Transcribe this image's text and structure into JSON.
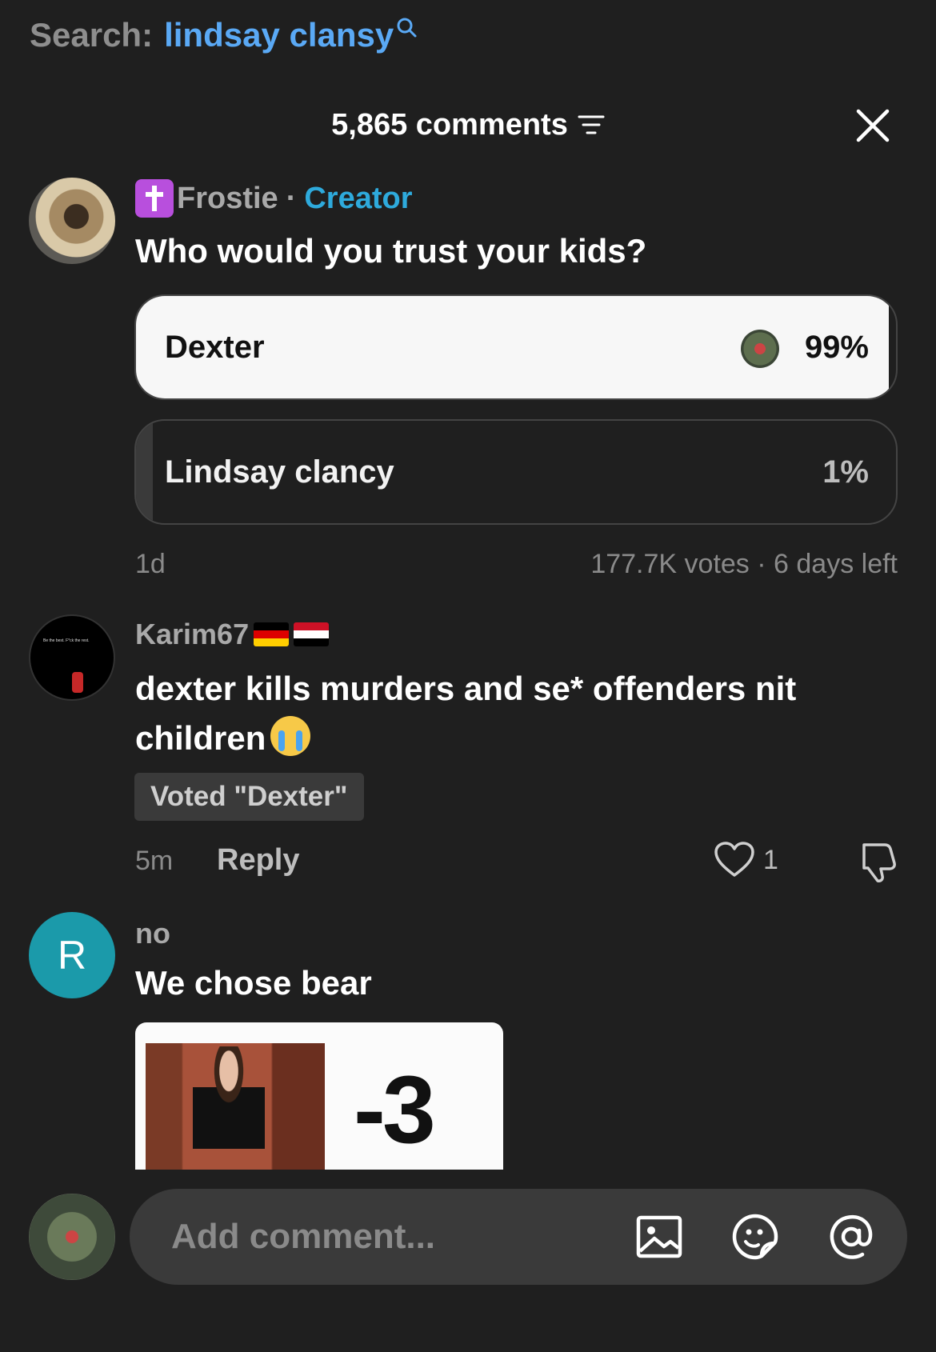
{
  "search": {
    "label": "Search:",
    "query": "lindsay clansy"
  },
  "header": {
    "comment_count": "5,865 comments"
  },
  "comments": [
    {
      "username": "Frostie",
      "separator": "·",
      "badge": "Creator",
      "text": "Who would you trust your kids?",
      "poll": {
        "options": [
          {
            "label": "Dexter",
            "percent": "99%",
            "value": 0.99
          },
          {
            "label": "Lindsay clancy",
            "percent": "1%",
            "value": 0.01
          }
        ],
        "age": "1d",
        "stats": "177.7K votes · 6 days left"
      }
    },
    {
      "username": "Karim67",
      "text": "dexter kills murders and se* offenders nit children",
      "voted_tag": "Voted \"Dexter\"",
      "time": "5m",
      "reply_label": "Reply",
      "likes": "1",
      "avatar_caption": "Be the best. F*ck the rest."
    },
    {
      "username": "no",
      "avatar_initial": "R",
      "text": "We chose bear",
      "attachment_text": "-3"
    }
  ],
  "composer": {
    "placeholder": "Add comment..."
  },
  "colors": {
    "background": "#1f1f1f",
    "creator": "#2eaadc",
    "search_query": "#5aa9f5",
    "avatar_r": "#1b9aaa"
  },
  "icons": [
    "search-icon",
    "filter-icon",
    "close-icon",
    "heart-icon",
    "dislike-icon",
    "image-icon",
    "sticker-icon",
    "mention-icon"
  ]
}
